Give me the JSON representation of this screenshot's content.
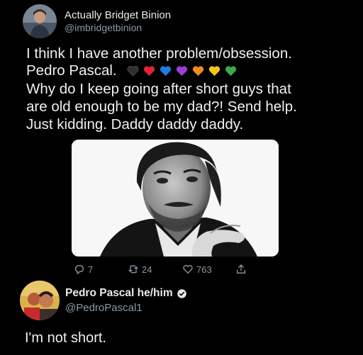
{
  "tweet": {
    "author_name": "Actually Bridget Binion",
    "author_handle": "@imbridgetbinion",
    "line1": "I think I have another problem/obsession.",
    "line2": "Pedro Pascal.",
    "line3": "Why do I keep going after short guys that",
    "line4": "are old enough to be my dad?! Send help.",
    "line5": "Just kidding. Daddy daddy daddy.",
    "hearts": [
      "black-heart",
      "red-heart",
      "blue-heart",
      "purple-heart",
      "orange-heart",
      "yellow-heart",
      "green-heart"
    ],
    "heart_colors": [
      "#2f2f2f",
      "#e3213b",
      "#1f7ae0",
      "#9b3fd6",
      "#f28a1c",
      "#f5c518",
      "#3aa94a"
    ],
    "replies": "7",
    "retweets": "24",
    "likes": "763"
  },
  "reply": {
    "author_name": "Pedro Pascal he/him",
    "author_handle": "@PedroPascal1",
    "text": "I'm not short."
  },
  "colors": {
    "background": "#000000",
    "text": "#e7e9ea",
    "secondary": "#8b98a5"
  }
}
